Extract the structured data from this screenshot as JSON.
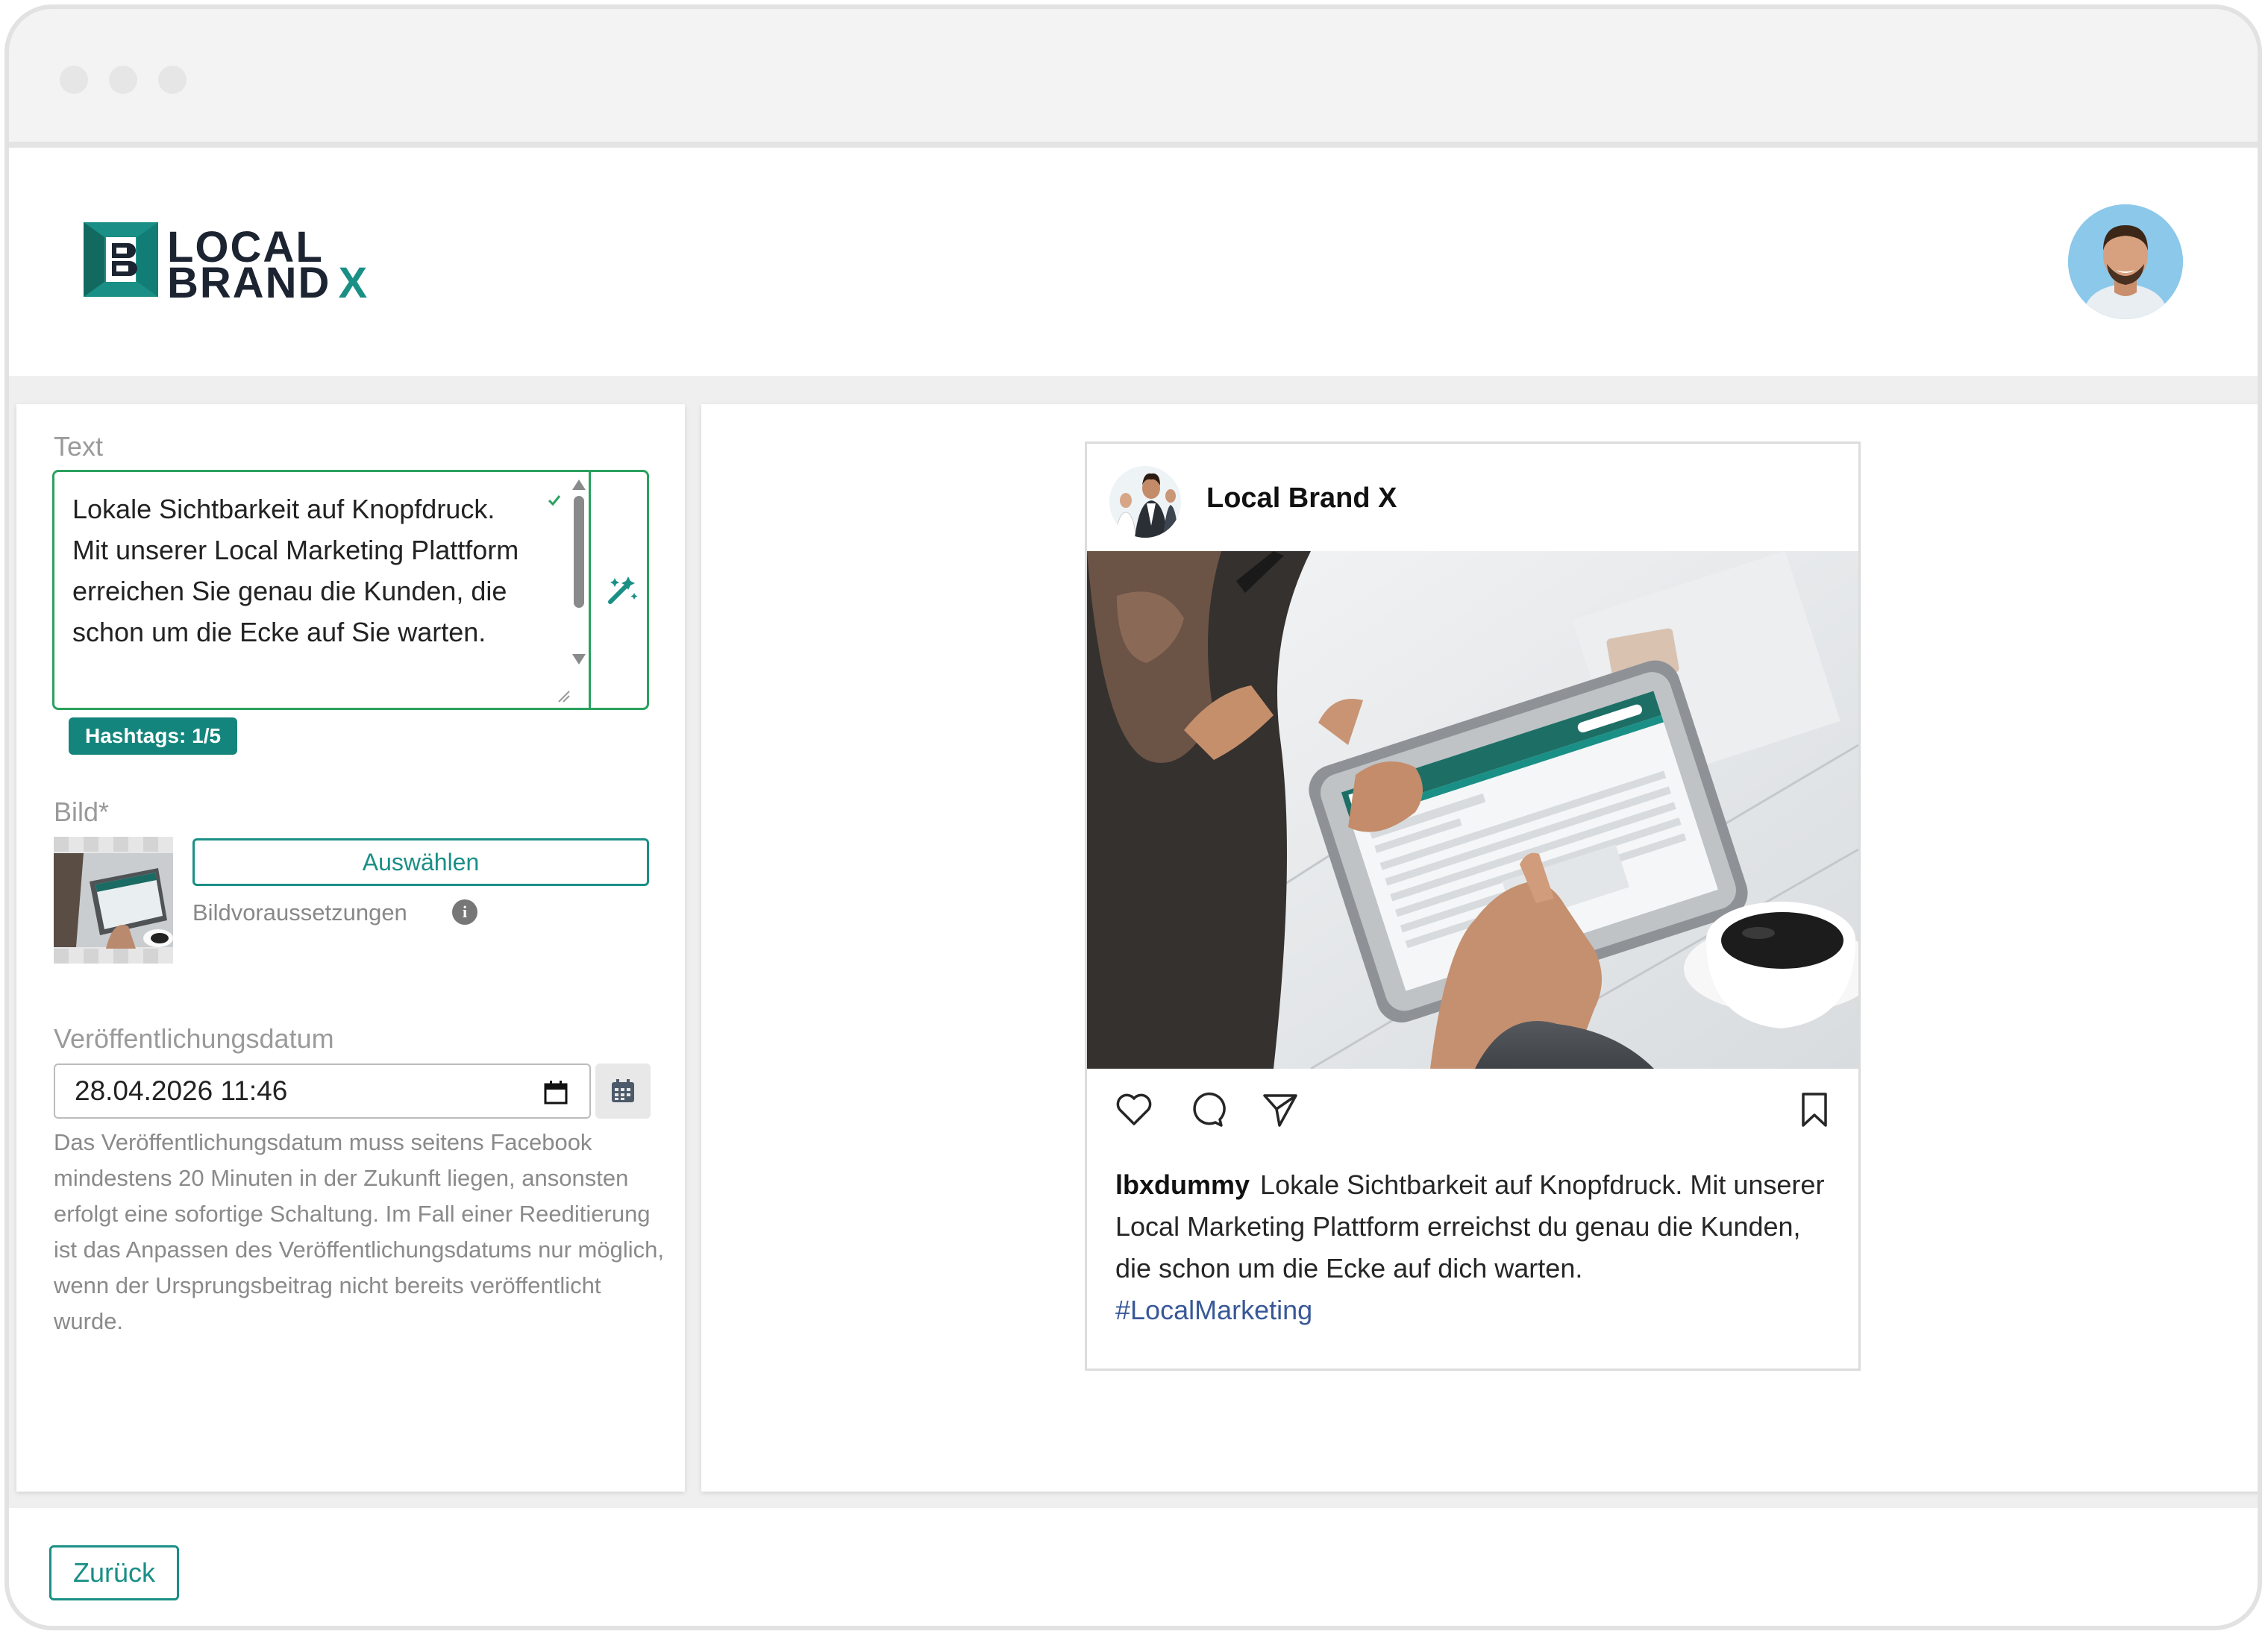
{
  "brand": {
    "logo_line1": "LOCAL",
    "logo_line2": "BRAND",
    "logo_x": "X",
    "accent_color": "#1a8f86",
    "dark_color": "#1c2431"
  },
  "left": {
    "text_label": "Text",
    "text_value": "Lokale Sichtbarkeit auf Knopfdruck. Mit unserer Local Marketing Plattform erreichen Sie genau die Kunden, die schon um die Ecke auf Sie warten.",
    "hashtags_badge": "Hashtags: 1/5",
    "image_label": "Bild*",
    "select_button": "Auswählen",
    "image_requirements": "Bildvoraussetzungen",
    "date_label": "Veröffentlichungsdatum",
    "date_value": "28.04.2026 11:46",
    "date_help": "Das Veröffentlichungsdatum muss seitens Facebook mindestens 20 Minuten in der Zukunft liegen, ansonsten erfolgt eine sofortige Schaltung. Im Fall einer Reeditierung ist das Anpassen des Veröffentlichungsdatums nur möglich, wenn der Ursprungsbeitrag nicht bereits veröffentlicht wurde."
  },
  "preview": {
    "brand_name": "Local Brand X",
    "username": "lbxdummy",
    "caption": "Lokale Sichtbarkeit auf Knopfdruck. Mit unserer Local Marketing Plattform erreichst du genau die Kunden, die schon um die Ecke auf dich warten.",
    "hashtag": "#LocalMarketing",
    "icons": [
      "heart-icon",
      "comment-icon",
      "share-icon",
      "bookmark-icon"
    ]
  },
  "footer": {
    "back_button": "Zurück"
  }
}
